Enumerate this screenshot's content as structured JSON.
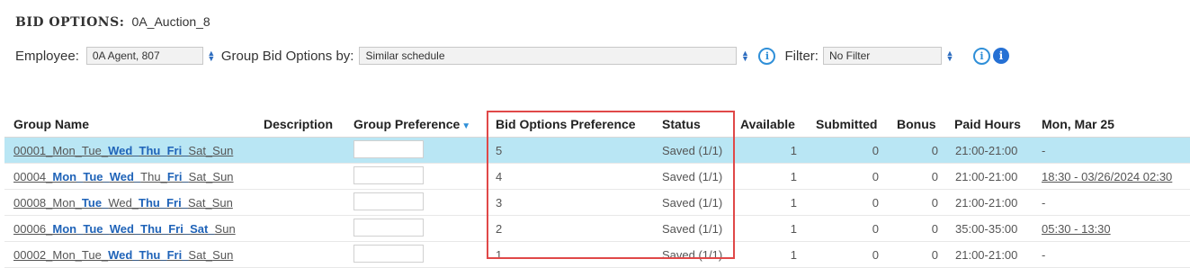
{
  "title": {
    "label": "BID OPTIONS:",
    "value": "0A_Auction_8"
  },
  "controls": {
    "employee_label": "Employee:",
    "employee_value": "0A Agent, 807",
    "group_label": "Group Bid Options by:",
    "group_value": "Similar schedule",
    "filter_label": "Filter:",
    "filter_value": "No Filter",
    "info_glyph": "i"
  },
  "table": {
    "headers": {
      "group_name": "Group Name",
      "description": "Description",
      "group_preference": "Group Preference",
      "bid_options_preference": "Bid Options Preference",
      "status": "Status",
      "available": "Available",
      "submitted": "Submitted",
      "bonus": "Bonus",
      "paid_hours": "Paid Hours",
      "day": "Mon, Mar 25"
    },
    "rows": [
      {
        "id": "00001_",
        "days": [
          [
            "Mon_",
            false
          ],
          [
            "Tue_",
            false
          ],
          [
            "Wed_",
            true
          ],
          [
            "Thu_",
            true
          ],
          [
            "Fri_",
            true
          ],
          [
            "Sat_",
            false
          ],
          [
            "Sun",
            false
          ]
        ],
        "bop": "5",
        "status": "Saved (1/1)",
        "available": "1",
        "submitted": "0",
        "bonus": "0",
        "paid_hours": "21:00-21:00",
        "day": "-",
        "day_link": false
      },
      {
        "id": "00004_",
        "days": [
          [
            "Mon_",
            true
          ],
          [
            "Tue_",
            true
          ],
          [
            "Wed_",
            true
          ],
          [
            "Thu_",
            false
          ],
          [
            "Fri_",
            true
          ],
          [
            "Sat_",
            false
          ],
          [
            "Sun",
            false
          ]
        ],
        "bop": "4",
        "status": "Saved (1/1)",
        "available": "1",
        "submitted": "0",
        "bonus": "0",
        "paid_hours": "21:00-21:00",
        "day": "18:30 - 03/26/2024 02:30",
        "day_link": true
      },
      {
        "id": "00008_",
        "days": [
          [
            "Mon_",
            false
          ],
          [
            "Tue_",
            true
          ],
          [
            "Wed_",
            false
          ],
          [
            "Thu_",
            true
          ],
          [
            "Fri_",
            true
          ],
          [
            "Sat_",
            false
          ],
          [
            "Sun",
            false
          ]
        ],
        "bop": "3",
        "status": "Saved (1/1)",
        "available": "1",
        "submitted": "0",
        "bonus": "0",
        "paid_hours": "21:00-21:00",
        "day": "-",
        "day_link": false
      },
      {
        "id": "00006_",
        "days": [
          [
            "Mon_",
            true
          ],
          [
            "Tue_",
            true
          ],
          [
            "Wed_",
            true
          ],
          [
            "Thu_",
            true
          ],
          [
            "Fri_",
            true
          ],
          [
            "Sat_",
            true
          ],
          [
            "Sun",
            false
          ]
        ],
        "bop": "2",
        "status": "Saved (1/1)",
        "available": "1",
        "submitted": "0",
        "bonus": "0",
        "paid_hours": "35:00-35:00",
        "day": "05:30 - 13:30",
        "day_link": true
      },
      {
        "id": "00002_",
        "days": [
          [
            "Mon_",
            false
          ],
          [
            "Tue_",
            false
          ],
          [
            "Wed_",
            true
          ],
          [
            "Thu_",
            true
          ],
          [
            "Fri_",
            true
          ],
          [
            "Sat_",
            false
          ],
          [
            "Sun",
            false
          ]
        ],
        "bop": "1",
        "status": "Saved (1/1)",
        "available": "1",
        "submitted": "0",
        "bonus": "0",
        "paid_hours": "21:00-21:00",
        "day": "-",
        "day_link": false
      }
    ]
  },
  "colors": {
    "selected_row": "#b9e6f4",
    "highlight_border": "#e04848",
    "link_blue": "#1f63b8"
  }
}
